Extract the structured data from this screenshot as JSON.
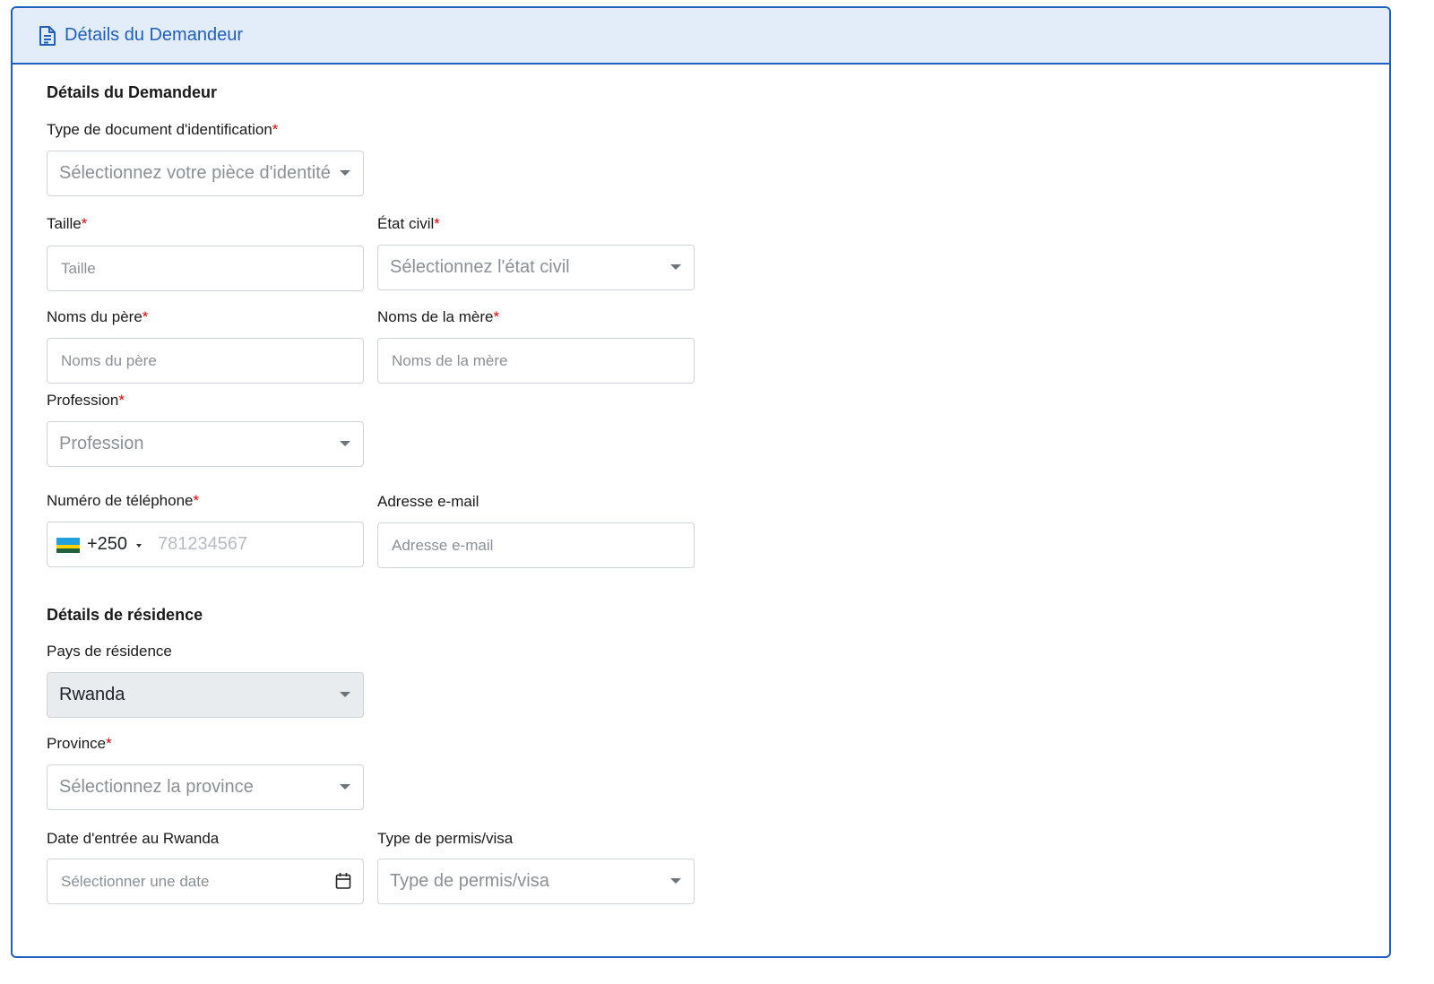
{
  "header": {
    "title": "Détails du Demandeur",
    "icon": "file-text-icon"
  },
  "applicant": {
    "section_title": "Détails du Demandeur",
    "id_type": {
      "label": "Type de document d'identification",
      "required": "*",
      "placeholder": "Sélectionnez votre pièce d'identité"
    },
    "height": {
      "label": "Taille",
      "required": "*",
      "placeholder": "Taille"
    },
    "marital": {
      "label": "État civil",
      "required": "*",
      "placeholder": "Sélectionnez l'état civil"
    },
    "father": {
      "label": "Noms du père",
      "required": "*",
      "placeholder": "Noms du père"
    },
    "mother": {
      "label": "Noms de la mère",
      "required": "*",
      "placeholder": "Noms de la mère"
    },
    "profession": {
      "label": "Profession",
      "required": "*",
      "placeholder": "Profession"
    },
    "phone": {
      "label": "Numéro de téléphone",
      "required": "*",
      "dial_code": "+250",
      "placeholder": "781234567",
      "flag": "rwanda-flag"
    },
    "email": {
      "label": "Adresse e-mail",
      "placeholder": "Adresse e-mail"
    }
  },
  "residence": {
    "section_title": "Détails de résidence",
    "country": {
      "label": "Pays de résidence",
      "value": "Rwanda"
    },
    "province": {
      "label": "Province",
      "required": "*",
      "placeholder": "Sélectionnez la province"
    },
    "entry_date": {
      "label": "Date d'entrée au Rwanda",
      "placeholder": "Sélectionner une date"
    },
    "permit": {
      "label": "Type de permis/visa",
      "placeholder": "Type de permis/visa"
    }
  },
  "colors": {
    "accent": "#1f5fbf",
    "header_bg": "#e2edf9",
    "required": "#e00000",
    "border": "#cfd4da"
  }
}
